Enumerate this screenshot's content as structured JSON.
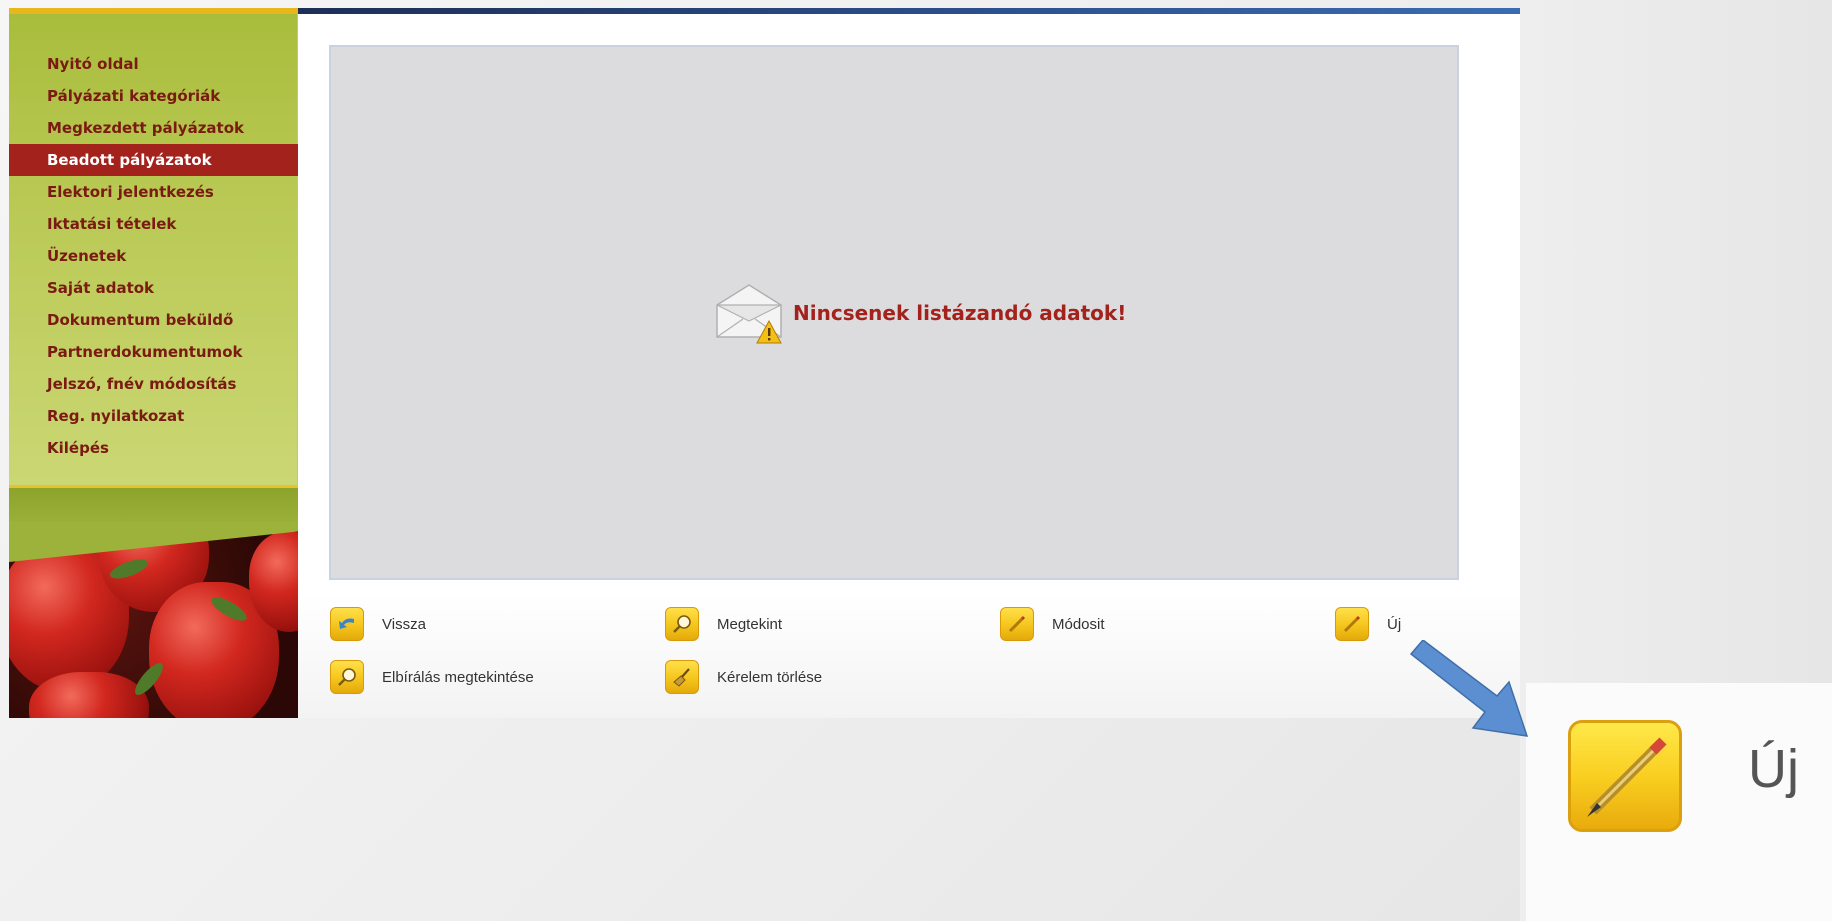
{
  "sidebar": {
    "items": [
      {
        "label": "Nyitó oldal",
        "active": false
      },
      {
        "label": "Pályázati kategóriák",
        "active": false
      },
      {
        "label": "Megkezdett pályázatok",
        "active": false
      },
      {
        "label": "Beadott pályázatok",
        "active": true
      },
      {
        "label": "Elektori jelentkezés",
        "active": false
      },
      {
        "label": "Iktatási tételek",
        "active": false
      },
      {
        "label": "Üzenetek",
        "active": false
      },
      {
        "label": "Saját adatok",
        "active": false
      },
      {
        "label": "Dokumentum beküldő",
        "active": false
      },
      {
        "label": "Partnerdokumentumok",
        "active": false
      },
      {
        "label": "Jelszó, fnév módosítás",
        "active": false
      },
      {
        "label": "Reg. nyilatkozat",
        "active": false
      },
      {
        "label": "Kilépés",
        "active": false
      }
    ]
  },
  "main": {
    "empty_message": "Nincsenek listázandó adatok!",
    "empty_icon": "envelope-warning-icon"
  },
  "actions": [
    {
      "label": "Vissza",
      "icon": "back-arrow-icon"
    },
    {
      "label": "Megtekint",
      "icon": "magnifier-icon"
    },
    {
      "label": "Módosit",
      "icon": "pencil-icon"
    },
    {
      "label": "Új",
      "icon": "pencil-icon"
    },
    {
      "label": "Elbírálás megtekintése",
      "icon": "magnifier-icon"
    },
    {
      "label": "Kérelem törlése",
      "icon": "broom-icon"
    }
  ],
  "zoom": {
    "label": "Új",
    "icon": "pencil-icon"
  },
  "colors": {
    "accent": "#a3221c",
    "sidebar_green": "#b9c954",
    "icon_yellow": "#f5c51c",
    "arrow_blue": "#5b8fd1",
    "top_bar_blue": "#2c4f8c"
  }
}
